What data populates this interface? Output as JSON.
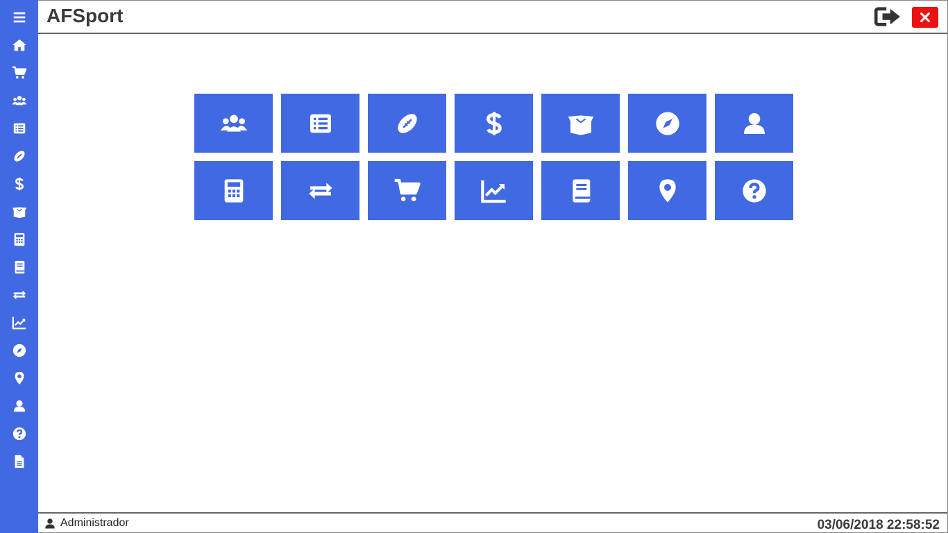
{
  "app": {
    "title": "AFSport"
  },
  "colors": {
    "accent": "#4169e1",
    "close": "#ee1111",
    "text": "#3a3a3a"
  },
  "header": {
    "logout_icon": "sign-out-icon",
    "close_icon": "close-icon"
  },
  "sidebar": {
    "items": [
      {
        "icon": "menu-icon"
      },
      {
        "icon": "home-icon"
      },
      {
        "icon": "cart-icon"
      },
      {
        "icon": "users-icon"
      },
      {
        "icon": "list-icon"
      },
      {
        "icon": "football-icon"
      },
      {
        "icon": "dollar-icon"
      },
      {
        "icon": "box-icon"
      },
      {
        "icon": "calculator-icon"
      },
      {
        "icon": "book-icon"
      },
      {
        "icon": "exchange-icon"
      },
      {
        "icon": "chart-icon"
      },
      {
        "icon": "compass-icon"
      },
      {
        "icon": "map-marker-icon"
      },
      {
        "icon": "user-icon"
      },
      {
        "icon": "help-icon"
      },
      {
        "icon": "document-icon"
      }
    ]
  },
  "tiles": {
    "row1": [
      "users-icon",
      "list-icon",
      "football-icon",
      "dollar-icon",
      "box-icon",
      "compass-icon",
      "user-icon"
    ],
    "row2": [
      "calculator-icon",
      "exchange-icon",
      "cart-icon",
      "chart-icon",
      "book-icon",
      "map-marker-icon",
      "help-icon"
    ]
  },
  "footer": {
    "user_icon": "user-icon",
    "user": "Administrador",
    "datetime": "03/06/2018 22:58:52"
  }
}
